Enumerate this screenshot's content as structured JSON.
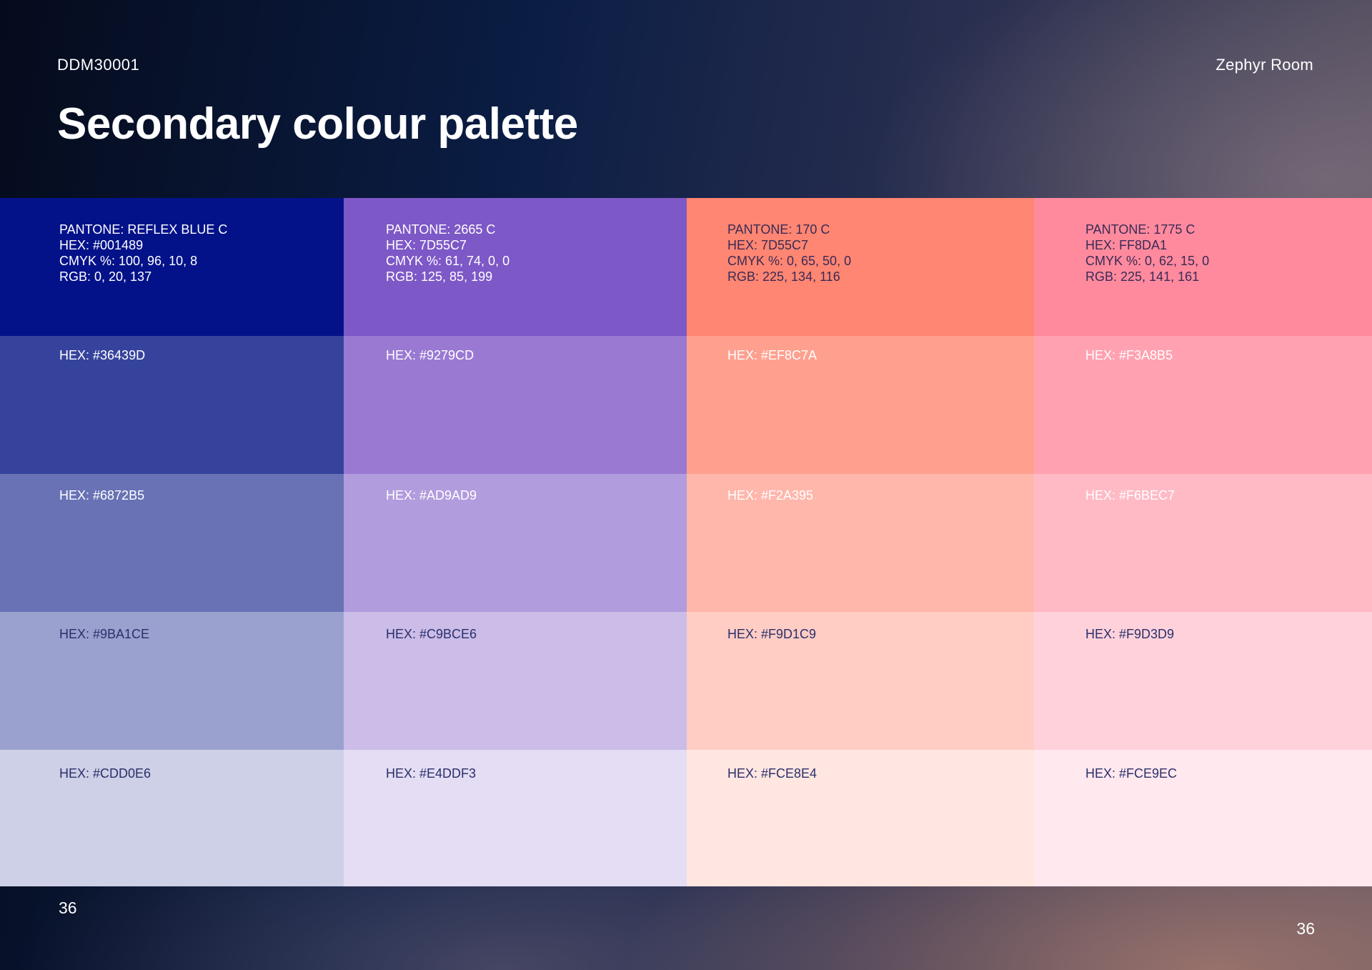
{
  "header": {
    "doc_code": "DDM30001",
    "brand": "Zephyr Room"
  },
  "title": "Secondary colour palette",
  "palette": {
    "columns": [
      {
        "primary": {
          "pantone": "PANTONE: REFLEX BLUE C",
          "hex": "HEX: #001489",
          "cmyk": "CMYK %: 100, 96, 10, 8",
          "rgb": "RGB: 0, 20, 137",
          "color": "#04128a"
        },
        "tints": [
          {
            "label": "HEX: #36439D",
            "color": "#36439d",
            "text_color": "#ffffff"
          },
          {
            "label": "HEX: #6872B5",
            "color": "#6872b5",
            "text_color": "#ffffff"
          },
          {
            "label": "HEX: #9BA1CE",
            "color": "#9ba1ce",
            "text_color": "#2a2f6a"
          },
          {
            "label": "HEX: #CDD0E6",
            "color": "#cdd0e6",
            "text_color": "#2a2f6a"
          }
        ]
      },
      {
        "primary": {
          "pantone": "PANTONE: 2665 C",
          "hex": "HEX: 7D55C7",
          "cmyk": "CMYK %: 61, 74, 0, 0",
          "rgb": "RGB: 125, 85, 199",
          "color": "#7d58c7"
        },
        "tints": [
          {
            "label": "HEX: #9279CD",
            "color": "#9a79d3",
            "text_color": "#ffffff"
          },
          {
            "label": "HEX: #AD9AD9",
            "color": "#b19cdd",
            "text_color": "#ffffff"
          },
          {
            "label": "HEX: #C9BCE6",
            "color": "#cbbce8",
            "text_color": "#2a2f6a"
          },
          {
            "label": "HEX: #E4DDF3",
            "color": "#e4ddf3",
            "text_color": "#2a2f6a"
          }
        ]
      },
      {
        "primary": {
          "pantone": "PANTONE: 170 C",
          "hex": "HEX: 7D55C7",
          "cmyk": "CMYK %: 0, 65, 50, 0",
          "rgb": "RGB: 225, 134, 116",
          "color": "#ff8672"
        },
        "tints": [
          {
            "label": "HEX: #EF8C7A",
            "color": "#ffa08f",
            "text_color": "#ffffff"
          },
          {
            "label": "HEX: #F2A395",
            "color": "#ffb7ab",
            "text_color": "#ffffff"
          },
          {
            "label": "HEX: #F9D1C9",
            "color": "#ffcdc4",
            "text_color": "#2a2f6a"
          },
          {
            "label": "HEX: #FCE8E4",
            "color": "#ffe6e1",
            "text_color": "#2a2f6a"
          }
        ]
      },
      {
        "primary": {
          "pantone": "PANTONE: 1775 C",
          "hex": "HEX: FF8DA1",
          "cmyk": "CMYK %: 0, 62, 15, 0",
          "rgb": "RGB: 225, 141, 161",
          "color": "#ff8a9e"
        },
        "tints": [
          {
            "label": "HEX: #F3A8B5",
            "color": "#ffa1b1",
            "text_color": "#ffffff"
          },
          {
            "label": "HEX: #F6BEC7",
            "color": "#ffbac6",
            "text_color": "#ffffff"
          },
          {
            "label": "HEX: #F9D3D9",
            "color": "#ffd2db",
            "text_color": "#2a2f6a"
          },
          {
            "label": "HEX: #FCE9EC",
            "color": "#ffe8ee",
            "text_color": "#2a2f6a"
          }
        ]
      }
    ]
  },
  "footer": {
    "page_left": "36",
    "page_right": "36"
  }
}
